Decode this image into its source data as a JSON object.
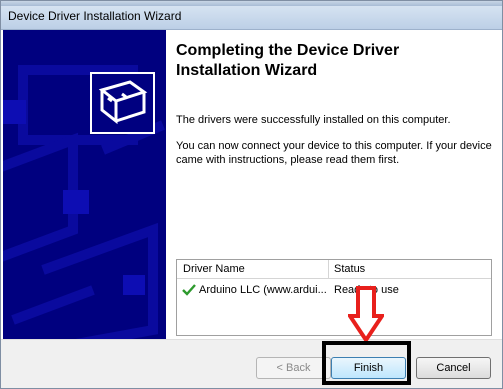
{
  "window": {
    "title": "Device Driver Installation Wizard"
  },
  "content": {
    "heading_line1": "Completing the Device Driver",
    "heading_line2": "Installation Wizard",
    "message1": "The drivers were successfully installed on this computer.",
    "message2_line1": "You can now connect your device to this computer. If your device",
    "message2_line2": "came with instructions, please read them first."
  },
  "driver_table": {
    "columns": [
      "Driver Name",
      "Status"
    ],
    "rows": [
      {
        "name": "Arduino LLC (www.ardui...",
        "status": "Ready to use",
        "icon": "green-check-icon"
      }
    ]
  },
  "buttons": {
    "back": "< Back",
    "finish": "Finish",
    "cancel": "Cancel"
  },
  "annotation": {
    "arrow_color": "#e8201c",
    "highlight_color": "#000000"
  },
  "colors": {
    "left_panel": "#00007f",
    "accent_check": "#2e9a2e"
  }
}
